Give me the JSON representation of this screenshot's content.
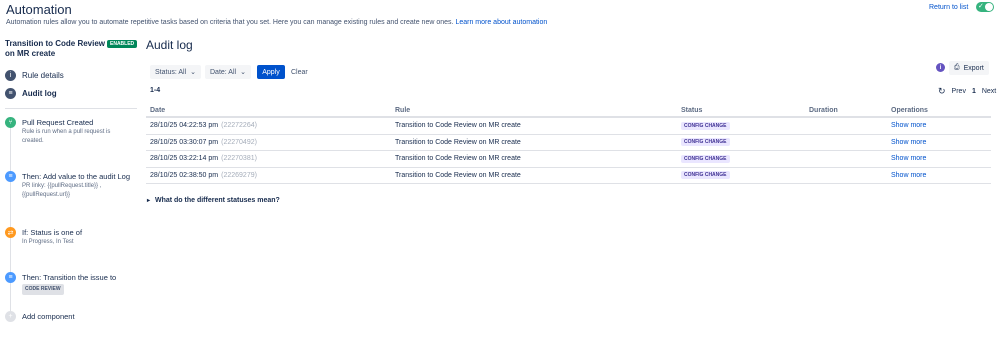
{
  "header": {
    "title": "Automation",
    "description": "Automation rules allow you to automate repetitive tasks based on criteria that you set. Here you can manage existing rules and create new ones.",
    "learn_more": "Learn more about automation",
    "return_link": "Return to list",
    "toggle_on": true
  },
  "rule": {
    "name": "Transition to Code Review on MR create",
    "badge": "ENABLED"
  },
  "nav": {
    "rule_details": "Rule details",
    "audit_log": "Audit log"
  },
  "flow": [
    {
      "title": "Pull Request Created",
      "desc": [
        "Rule is run when a pull request is",
        "created."
      ],
      "color": "#36B37E",
      "icon": "branch-icon"
    },
    {
      "title": "Then: Add value to the audit Log",
      "desc": [
        "PR linky: {{pullRequest.title}} ,",
        "{{pullRequest.url}}"
      ],
      "color": "#4C9AFF",
      "icon": "list-icon"
    },
    {
      "title": "If: Status is one of",
      "desc": [
        "In Progress, In Test"
      ],
      "color": "#FF991F",
      "icon": "shuffle-icon"
    },
    {
      "title": "Then: Transition the issue to",
      "tag": "CODE REVIEW",
      "color": "#4C9AFF",
      "icon": "list-icon"
    }
  ],
  "add_component": "Add component",
  "audit": {
    "title": "Audit log",
    "filters": {
      "status": "Status: All",
      "date": "Date: All",
      "apply": "Apply",
      "clear": "Clear"
    },
    "count": "1-4",
    "export": "Export",
    "pagination": {
      "prev": "Prev",
      "current": "1",
      "next": "Next"
    },
    "columns": [
      "Date",
      "Rule",
      "Status",
      "Duration",
      "Operations"
    ],
    "rows": [
      {
        "date": "28/10/25 04:22:53 pm",
        "id": "(22272264)",
        "rule": "Transition to Code Review on MR create",
        "status": "CONFIG CHANGE",
        "duration": "",
        "op": "Show more"
      },
      {
        "date": "28/10/25 03:30:07 pm",
        "id": "(22270492)",
        "rule": "Transition to Code Review on MR create",
        "status": "CONFIG CHANGE",
        "duration": "",
        "op": "Show more"
      },
      {
        "date": "28/10/25 03:22:14 pm",
        "id": "(22270381)",
        "rule": "Transition to Code Review on MR create",
        "status": "CONFIG CHANGE",
        "duration": "",
        "op": "Show more"
      },
      {
        "date": "28/10/25 02:38:50 pm",
        "id": "(22269279)",
        "rule": "Transition to Code Review on MR create",
        "status": "CONFIG CHANGE",
        "duration": "",
        "op": "Show more"
      }
    ],
    "statuses_question": "What do the different statuses mean?"
  }
}
